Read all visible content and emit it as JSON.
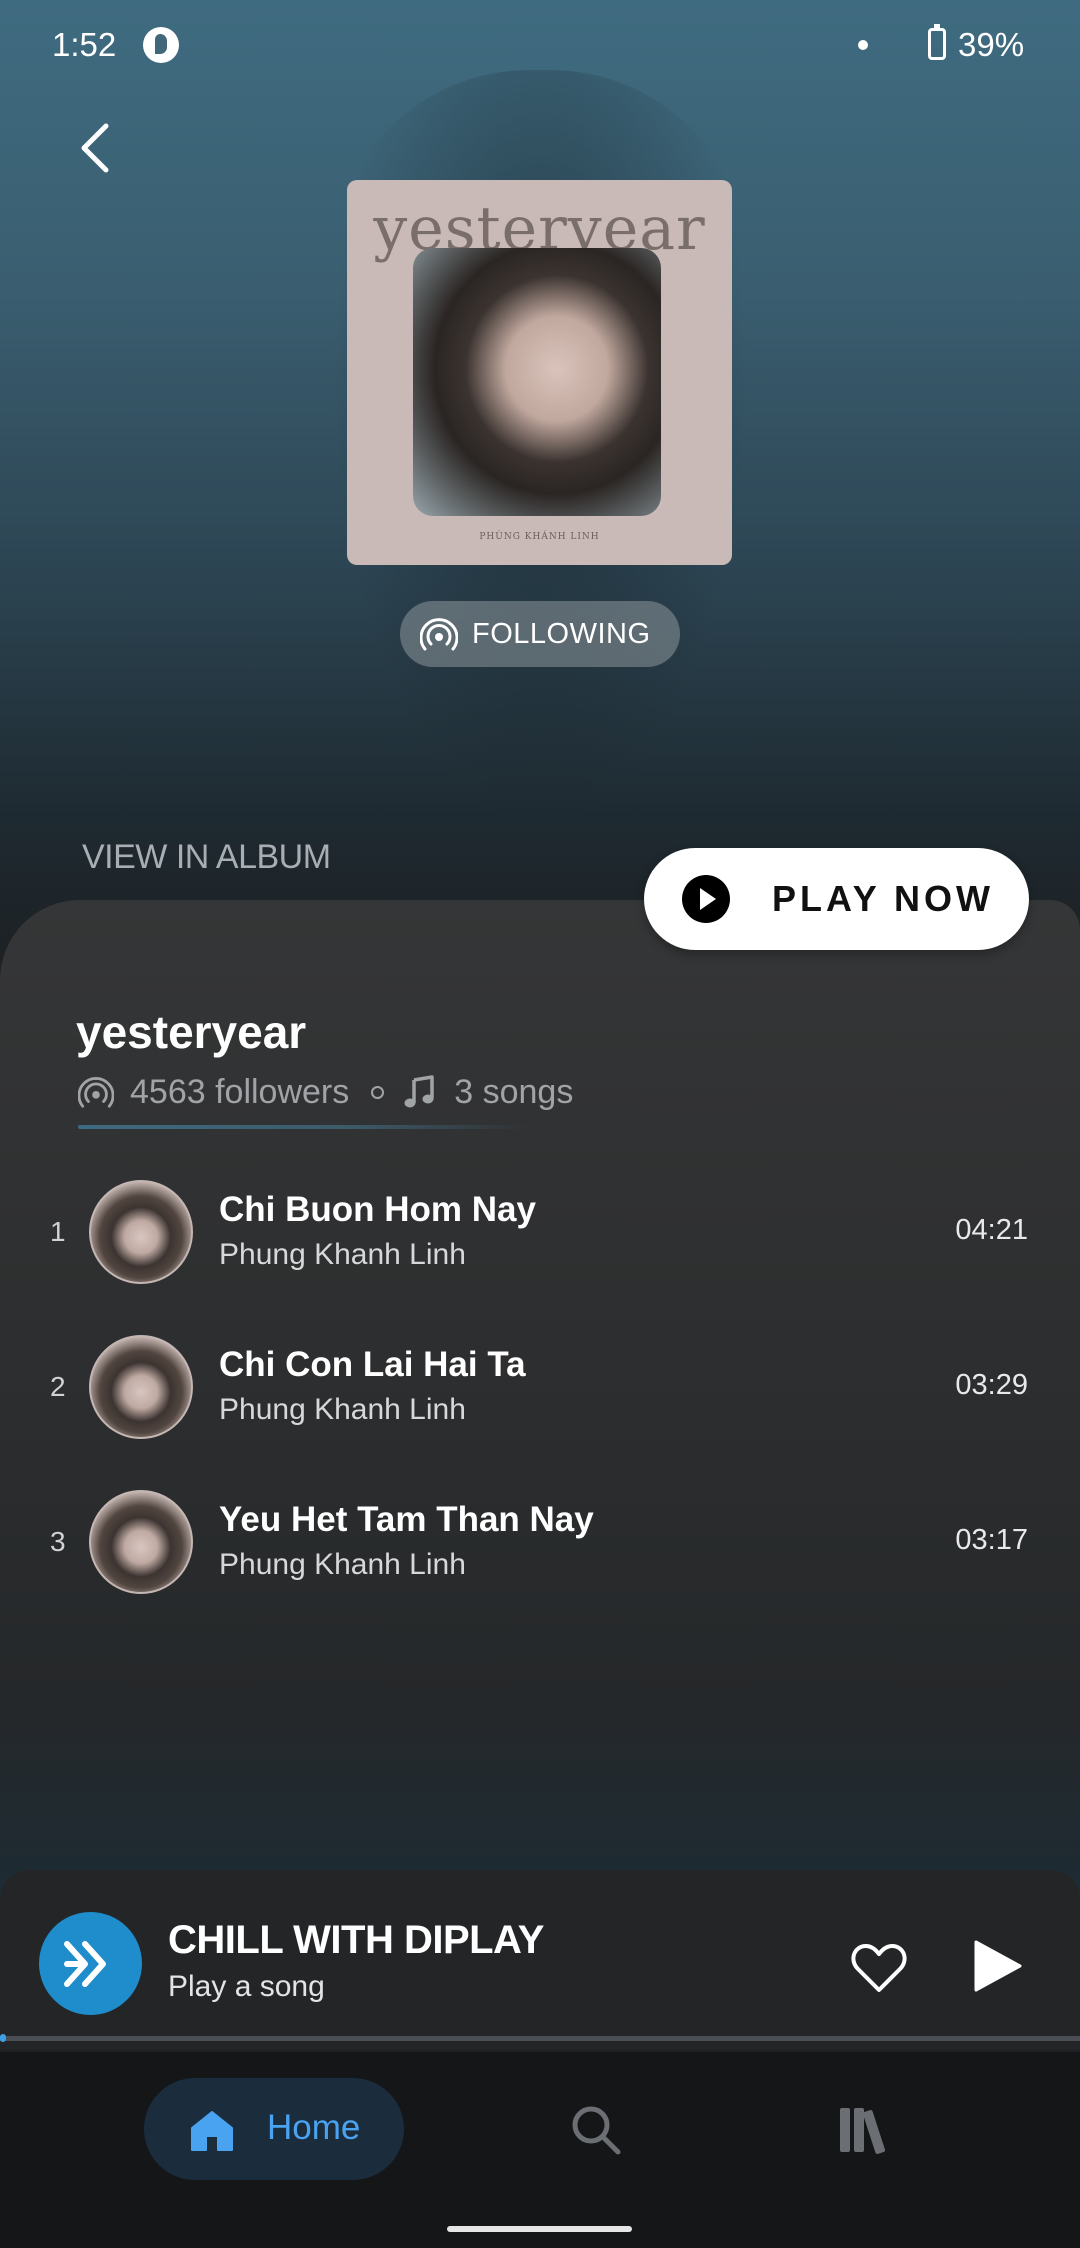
{
  "status_bar": {
    "time": "1:52",
    "battery": "39%"
  },
  "cover": {
    "title": "yesteryear",
    "artist_caption": "PHÙNG KHÁNH LINH"
  },
  "follow_button": {
    "label": "FOLLOWING"
  },
  "view_in_album": "VIEW IN ALBUM",
  "play_now": "PLAY NOW",
  "album": {
    "title": "yesteryear",
    "followers": "4563 followers",
    "songs": "3 songs"
  },
  "tracks": [
    {
      "num": "1",
      "title": "Chi Buon Hom Nay",
      "artist": "Phung Khanh Linh",
      "duration": "04:21"
    },
    {
      "num": "2",
      "title": "Chi Con Lai Hai Ta",
      "artist": "Phung Khanh Linh",
      "duration": "03:29"
    },
    {
      "num": "3",
      "title": "Yeu Het Tam Than Nay",
      "artist": "Phung Khanh Linh",
      "duration": "03:17"
    }
  ],
  "mini_player": {
    "title": "CHILL WITH DIPLAY",
    "subtitle": "Play a song",
    "progress": 0.005
  },
  "nav": {
    "home": "Home"
  },
  "colors": {
    "accent": "#3aa0e8",
    "logo_bg": "#1f8ccc",
    "nav_active_bg": "#1b2c3c"
  }
}
